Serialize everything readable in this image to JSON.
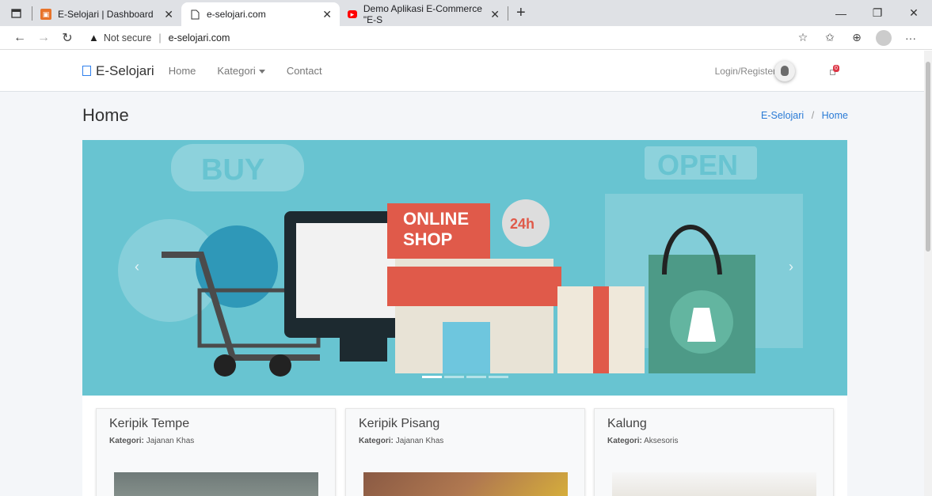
{
  "browser": {
    "tabs": [
      {
        "title": "E-Selojari | Dashboard",
        "active": false
      },
      {
        "title": "e-selojari.com",
        "active": true
      },
      {
        "title": "Demo Aplikasi E-Commerce \"E-S",
        "active": false
      }
    ],
    "url_warning": "Not secure",
    "url": "e-selojari.com"
  },
  "navbar": {
    "brand": "E-Selojari",
    "links": [
      "Home",
      "Kategori",
      "Contact"
    ],
    "login": "Login/Register",
    "cart_count": "0"
  },
  "header": {
    "title": "Home",
    "breadcrumb": [
      "E-Selojari",
      "Home"
    ]
  },
  "carousel": {
    "banner_texts": [
      "BUY",
      "OPEN",
      "ONLINE",
      "SHOP",
      "24h"
    ],
    "active_index": 0,
    "slide_count": 4
  },
  "products": [
    {
      "name": "Keripik Tempe",
      "category_label": "Kategori:",
      "category": "Jajanan Khas"
    },
    {
      "name": "Keripik Pisang",
      "category_label": "Kategori:",
      "category": "Jajanan Khas"
    },
    {
      "name": "Kalung",
      "category_label": "Kategori:",
      "category": "Aksesoris"
    }
  ],
  "colors": {
    "banner_bg": "#68c4d1",
    "link_blue": "#2a7bd6",
    "badge_red": "#dc3545"
  }
}
